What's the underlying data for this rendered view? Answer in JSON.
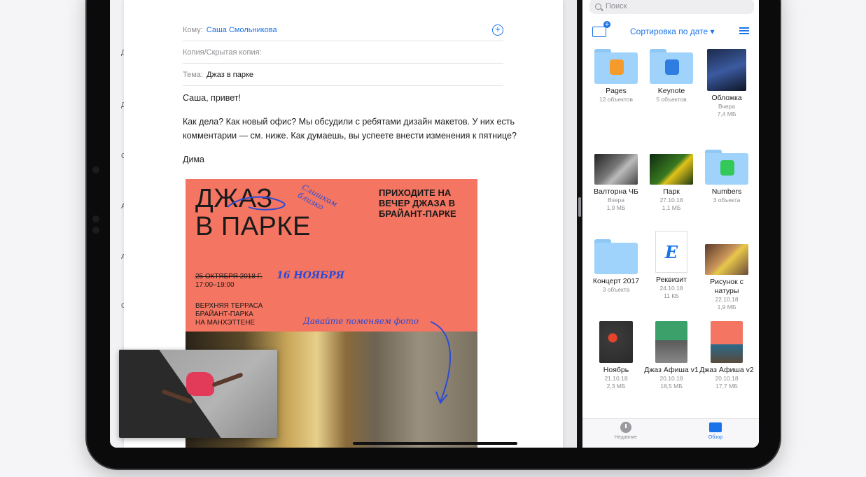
{
  "mail": {
    "to_label": "Кому:",
    "to_value": "Саша Смольникова",
    "cc_label": "Копия/Скрытая копия:",
    "subject_label": "Тема:",
    "subject_value": "Джаз в парке",
    "greeting": "Саша, привет!",
    "body": "Как дела? Как новый офис? Мы обсудили с ребятами дизайн макетов. У них есть комментарии — см. ниже. Как думаешь, вы успеете внести изменения к пятнице?",
    "signature": "Дима",
    "add_icon": "+"
  },
  "poster": {
    "title_line1": "ДЖАЗ",
    "title_line2": "В ПАРКЕ",
    "invite": "ПРИХОДИТЕ НА ВЕЧЕР ДЖАЗА В БРАЙАНТ-ПАРКЕ",
    "date": "25 ОКТЯБРЯ 2018 Г.",
    "time": "17:00–19:00",
    "venue_line1": "ВЕРХНЯЯ ТЕРРАСА",
    "venue_line2": "БРАЙАНТ-ПАРКА",
    "venue_line3": "НА МАНХЭТТЕНЕ",
    "note_close": "Слишком близко",
    "note_date": "16 НОЯБРЯ",
    "note_photo": "Давайте поменяем фото"
  },
  "files": {
    "search_placeholder": "Поиск",
    "sort_label": "Сортировка по дате ▾",
    "items": [
      {
        "name": "Pages",
        "meta1": "12 объектов",
        "meta2": ""
      },
      {
        "name": "Keynote",
        "meta1": "5 объектов",
        "meta2": ""
      },
      {
        "name": "Обложка",
        "meta1": "Вчера",
        "meta2": "7,4 МБ"
      },
      {
        "name": "Валторна ЧБ",
        "meta1": "Вчера",
        "meta2": "1,9 МБ"
      },
      {
        "name": "Парк",
        "meta1": "27.10.18",
        "meta2": "1,1 МБ"
      },
      {
        "name": "Numbers",
        "meta1": "3 объекта",
        "meta2": ""
      },
      {
        "name": "Концерт 2017",
        "meta1": "3 объекта",
        "meta2": ""
      },
      {
        "name": "Реквизит",
        "meta1": "24.10.18",
        "meta2": "11 КБ"
      },
      {
        "name": "Рисунок с натуры",
        "meta1": "22.10.18",
        "meta2": "1,9 МБ"
      },
      {
        "name": "Ноябрь",
        "meta1": "21.10.18",
        "meta2": "2,3 МБ"
      },
      {
        "name": "Джаз Афиша v1",
        "meta1": "20.10.18",
        "meta2": "18,5 МБ"
      },
      {
        "name": "Джаз Афиша v2",
        "meta1": "20.10.18",
        "meta2": "17,7 МБ"
      }
    ],
    "doc_letter": "E",
    "tabs": {
      "recent": "Недавние",
      "browse": "Обзор"
    }
  },
  "colors": {
    "accent": "#1a73e8",
    "poster": "#f47561",
    "annotation": "#2a4bd7"
  }
}
